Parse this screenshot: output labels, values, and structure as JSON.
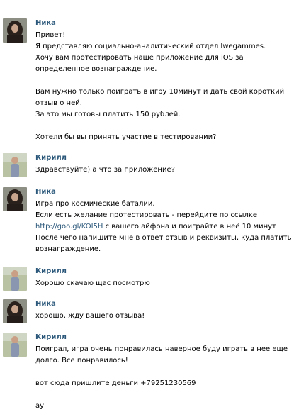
{
  "messages": [
    {
      "author": "Ника",
      "avatar": "female-avatar",
      "lines": [
        "Привет!",
        "Я представляю социально-аналитический отдел Iwegammes.",
        "Хочу вам протестировать наше приложение для iOS за",
        "определенное вознаграждение.",
        "",
        "Вам нужно только поиграть в игру 10минут и дать свой короткий",
        "отзыв о ней.",
        "За это мы готовы платить 150 рублей.",
        "",
        "Хотели бы вы принять участие в тестировании?"
      ]
    },
    {
      "author": "Кирилл",
      "avatar": "male-avatar",
      "lines": [
        "Здравствуйте) а что за приложение?"
      ]
    },
    {
      "author": "Ника",
      "avatar": "female-avatar",
      "lines": [
        "Игра про космические баталии.",
        "Если есть желание протестировать - перейдите по ссылке",
        "",
        "После чего напишите мне в ответ отзыв и реквизиты, куда платить",
        "вознаграждение."
      ],
      "link": "http://goo.gl/KOI5H",
      "link_rest": " с вашего айфона и поиграйте в неё 10 минут"
    },
    {
      "author": "Кирилл",
      "avatar": "male-avatar",
      "lines": [
        "Хорошо скачаю щас посмотрю"
      ]
    },
    {
      "author": "Ника",
      "avatar": "female-avatar",
      "lines": [
        "хорошо, жду вашего отзыва!"
      ]
    },
    {
      "author": "Кирилл",
      "avatar": "male-avatar",
      "lines": [
        "Поиграл, игра очень понравилась наверное буду играть в нее еще",
        "долго. Все понравилось!",
        "",
        "вот сюда пришлите деньги +79251230569",
        "",
        "ау"
      ]
    }
  ]
}
